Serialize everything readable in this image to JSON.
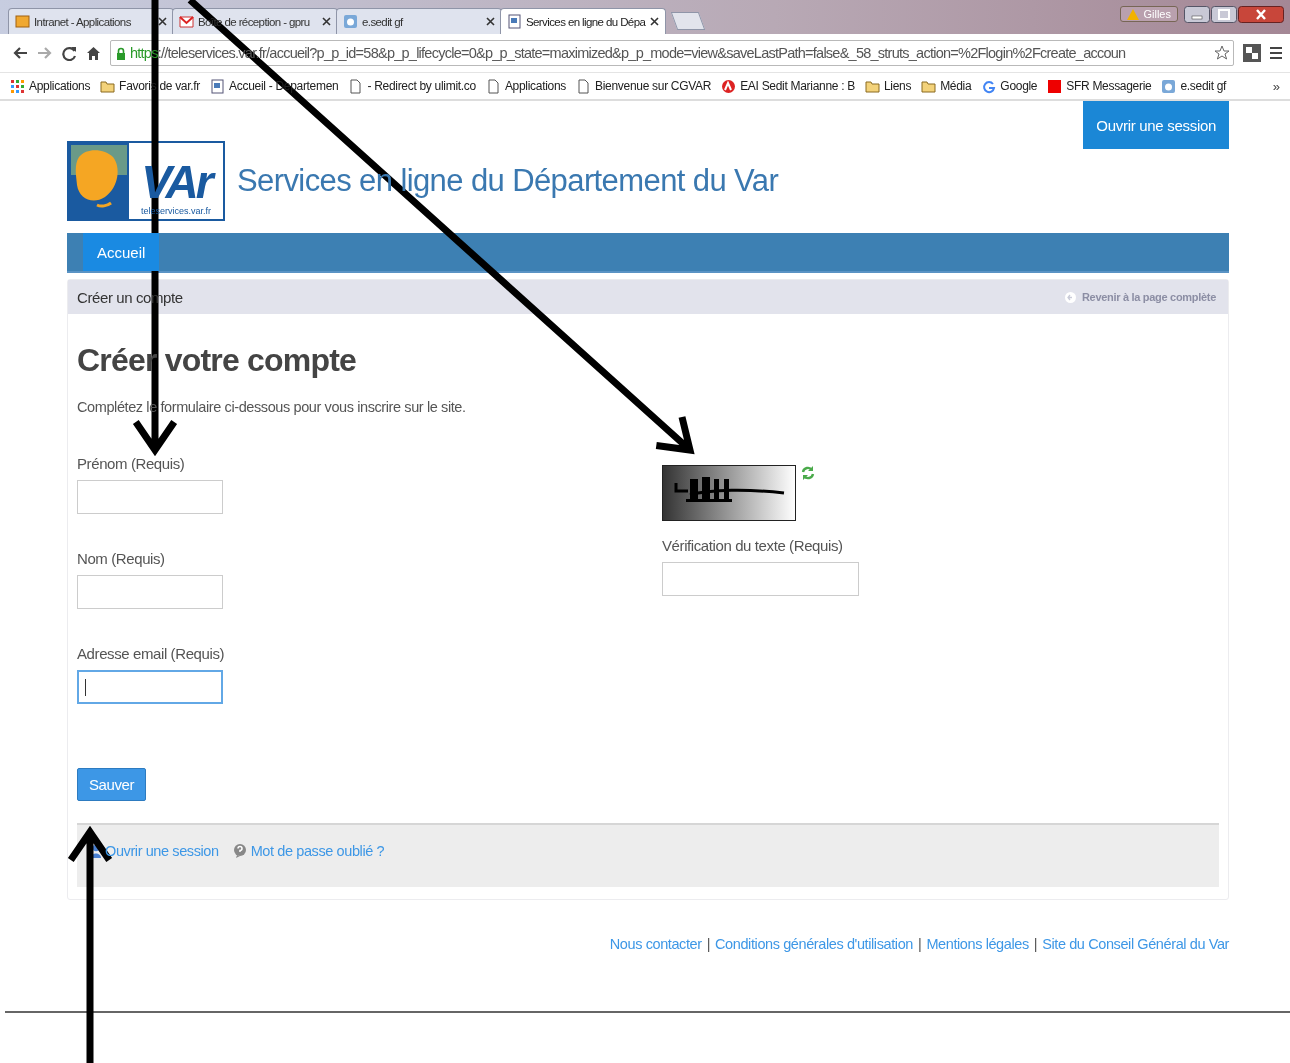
{
  "browser": {
    "tabs": [
      {
        "label": "Intranet - Applications",
        "selected": false
      },
      {
        "label": "Boîte de réception - gpru",
        "selected": false
      },
      {
        "label": "e.sedit gf",
        "selected": false
      },
      {
        "label": "Services en ligne du Dépa",
        "selected": true
      }
    ],
    "profile": "Gilles",
    "url": {
      "scheme": "https",
      "rest": "://teleservices.var.fr/accueil?p_p_id=58&p_p_lifecycle=0&p_p_state=maximized&p_p_mode=view&saveLastPath=false&_58_struts_action=%2Flogin%2Fcreate_accoun"
    },
    "bookmarks": [
      "Applications",
      "Favoris de var.fr",
      "Accueil - Departemen",
      "- Redirect by ulimit.co",
      "Applications",
      "Bienvenue sur CGVAR",
      "EAI Sedit Marianne : B",
      "Liens",
      "Média",
      "Google",
      "SFR Messagerie",
      "e.sedit gf"
    ],
    "overflow": "»"
  },
  "page": {
    "login_button": "Ouvrir une session",
    "logo": {
      "word": "VAr",
      "caption": "teleservices.var.fr"
    },
    "site_title": "Services en ligne du Département du Var",
    "nav": [
      {
        "label": "Accueil",
        "selected": true
      }
    ],
    "portlet": {
      "title": "Créer un compte",
      "back_link": "Revenir à la page complète"
    },
    "heading": "Créer votre compte",
    "intro": "Complétez le formulaire ci-dessous pour vous inscrire sur le site.",
    "fields": [
      {
        "label": "Prénom (Requis)",
        "focused": false
      },
      {
        "label": "Nom (Requis)",
        "focused": false
      },
      {
        "label": "Adresse email (Requis)",
        "focused": true
      }
    ],
    "captcha": {
      "label": "Vérification du texte (Requis)"
    },
    "save_button": "Sauver",
    "bottom_links": [
      "Ouvrir une session",
      "Mot de passe oublié ?"
    ],
    "footer_links": [
      "Nous contacter",
      "Conditions générales d'utilisation",
      "Mentions légales",
      "Site du Conseil Général du Var"
    ],
    "footer_separator": "|"
  },
  "annotations": [
    {
      "kind": "down"
    },
    {
      "kind": "diagonal"
    },
    {
      "kind": "up"
    }
  ]
}
